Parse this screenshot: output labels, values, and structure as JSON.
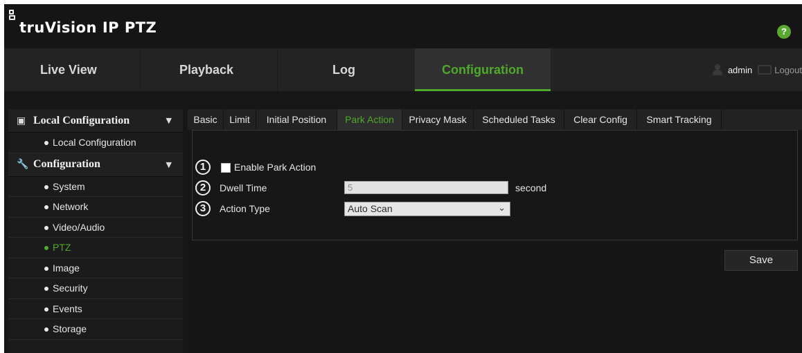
{
  "app": {
    "logo_prefix": "truVision",
    "logo_suffix": "IP PTZ",
    "help_label": "?"
  },
  "nav": {
    "tabs": [
      {
        "label": "Live View"
      },
      {
        "label": "Playback"
      },
      {
        "label": "Log"
      },
      {
        "label": "Configuration"
      }
    ],
    "active_tab": "Configuration",
    "user_label": "admin",
    "logout_label": "Logout"
  },
  "sidebar": {
    "sections": [
      {
        "label": "Local Configuration",
        "items": [
          "Local Configuration"
        ]
      },
      {
        "label": "Configuration",
        "items": [
          "System",
          "Network",
          "Video/Audio",
          "PTZ",
          "Image",
          "Security",
          "Events",
          "Storage"
        ]
      }
    ],
    "active_item": "PTZ"
  },
  "subtabs": {
    "items": [
      "Basic",
      "Limit",
      "Initial Position",
      "Park Action",
      "Privacy Mask",
      "Scheduled Tasks",
      "Clear Config",
      "Smart Tracking"
    ],
    "active": "Park Action"
  },
  "form": {
    "callout_1": "1",
    "callout_2": "2",
    "callout_3": "3",
    "enable_label": "Enable Park Action",
    "enable_checked": false,
    "dwell_label": "Dwell Time",
    "dwell_value": "5",
    "dwell_unit": "second",
    "action_label": "Action Type",
    "action_value": "Auto Scan"
  },
  "actions": {
    "save_label": "Save"
  },
  "colors": {
    "accent": "#4fa92c",
    "background": "#171717",
    "nav_background": "#232323"
  }
}
